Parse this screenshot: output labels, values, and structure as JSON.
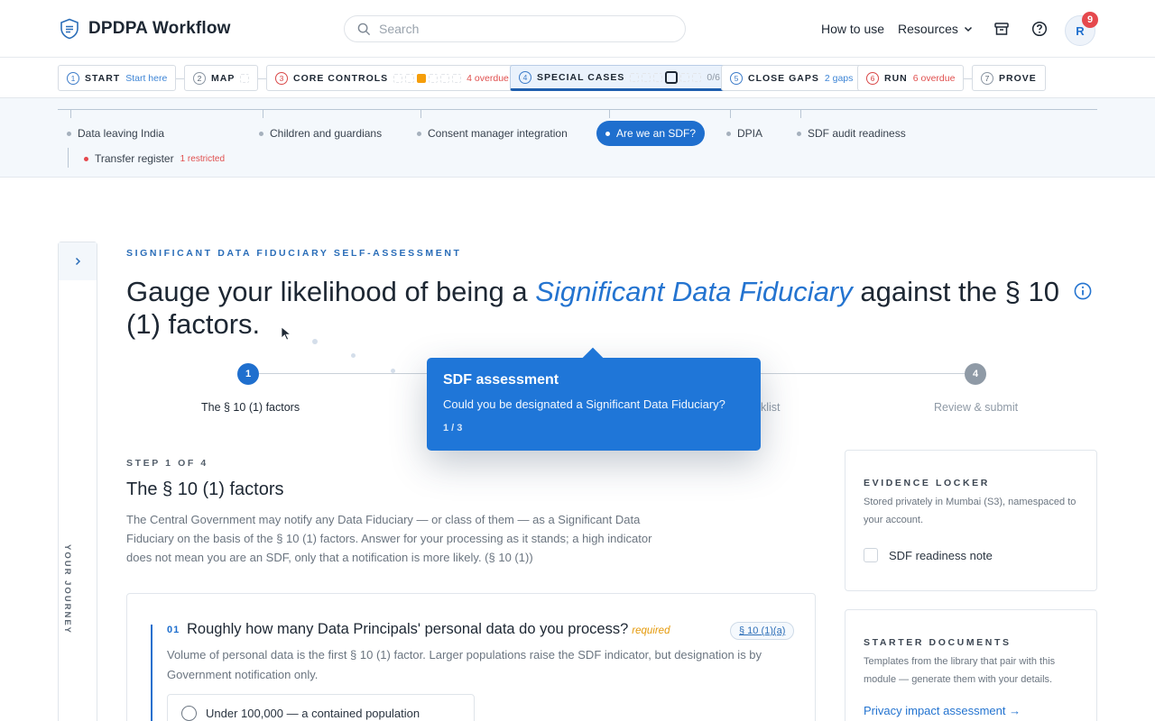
{
  "app": {
    "title": "DPDPA Workflow",
    "search_placeholder": "Search",
    "nav_how": "How to use",
    "nav_resources": "Resources",
    "avatar_initial": "R",
    "notification_count": "9",
    "accent": "#1f6fce"
  },
  "workflow": {
    "steps": [
      {
        "num": "1",
        "label": "START",
        "sub": "Start here"
      },
      {
        "num": "2",
        "label": "MAP",
        "sub": ""
      },
      {
        "num": "3",
        "label": "CORE CONTROLS",
        "sub": "4 overdue"
      },
      {
        "num": "4",
        "label": "SPECIAL CASES",
        "sub": "0/6"
      },
      {
        "num": "5",
        "label": "CLOSE GAPS",
        "sub": "2 gaps"
      },
      {
        "num": "6",
        "label": "RUN",
        "sub": "6 overdue"
      },
      {
        "num": "7",
        "label": "PROVE",
        "sub": ""
      }
    ]
  },
  "subnav": {
    "items": [
      {
        "label": "Data leaving India"
      },
      {
        "label": "Children and guardians"
      },
      {
        "label": "Consent manager integration"
      },
      {
        "label": "Are we an SDF?"
      },
      {
        "label": "DPIA"
      },
      {
        "label": "SDF audit readiness"
      }
    ],
    "child": {
      "label": "Transfer register",
      "status": "1 restricted"
    }
  },
  "journey": {
    "label": "YOUR JOURNEY"
  },
  "main": {
    "eyebrow": "SIGNIFICANT DATA FIDUCIARY SELF-ASSESSMENT",
    "headline_pre": "Gauge your likelihood of being a ",
    "headline_em": "Significant Data Fiduciary",
    "headline_post": " against the § 10 (1) factors.",
    "wizard": [
      {
        "num": "1",
        "label": "The § 10 (1) factors"
      },
      {
        "num": "2",
        "label": ""
      },
      {
        "num": "3",
        "label": "klist"
      },
      {
        "num": "4",
        "label": "Review & submit"
      }
    ],
    "step_label": "STEP 1 OF 4",
    "step_title": "The § 10 (1) factors",
    "step_desc": "The Central Government may notify any Data Fiduciary — or class of them — as a Significant Data Fiduciary on the basis of the § 10 (1) factors. Answer for your processing as it stands; a high indicator does not mean you are an SDF, only that a notification is more likely. (§ 10 (1))"
  },
  "question": {
    "num": "01",
    "text": "Roughly how many Data Principals' personal data do you process?",
    "required": "required",
    "ref": "§ 10 (1)(a)",
    "desc": "Volume of personal data is the first § 10 (1) factor. Larger populations raise the SDF indicator, but designation is by Government notification only.",
    "option1": "Under 100,000 — a contained population"
  },
  "evidence": {
    "title": "EVIDENCE LOCKER",
    "desc": "Stored privately in Mumbai (S3), namespaced to your account.",
    "item": "SDF readiness note"
  },
  "starter": {
    "title": "STARTER DOCUMENTS",
    "desc": "Templates from the library that pair with this module — generate them with your details.",
    "link": "Privacy impact assessment →"
  },
  "popover": {
    "title": "SDF assessment",
    "body": "Could you be designated a Significant Data Fiduciary?",
    "count": "1 / 3"
  }
}
